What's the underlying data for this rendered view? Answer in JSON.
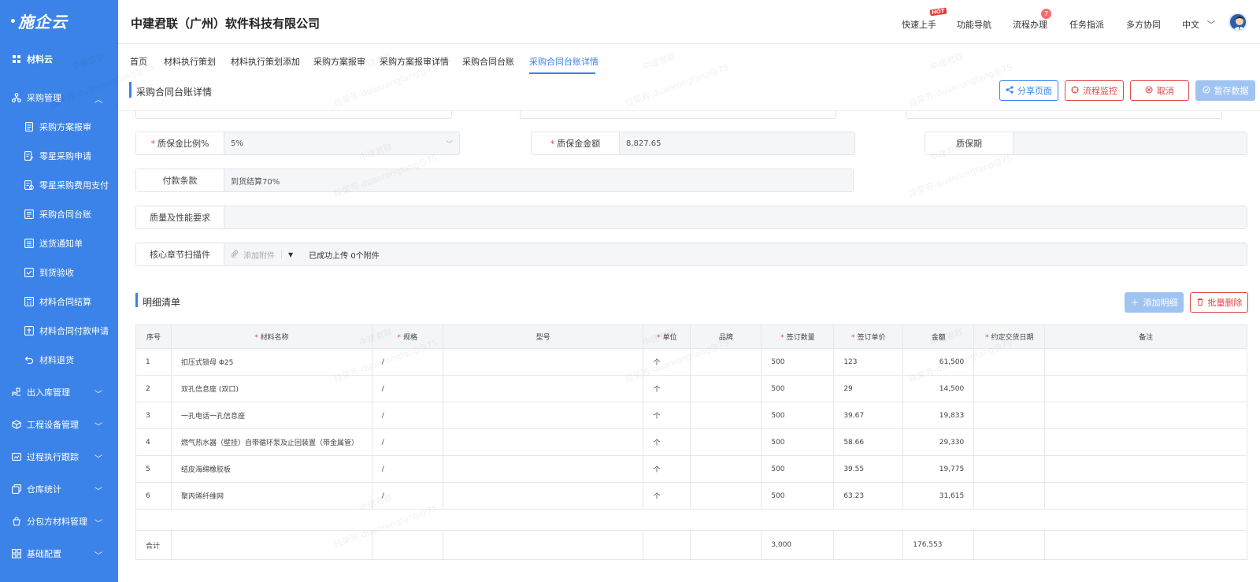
{
  "app": {
    "logo": "施企云",
    "company": "中建君联（广州）软件科技有限公司"
  },
  "sidebar": {
    "items": [
      {
        "label": "材料云",
        "icon": "grid-icon"
      },
      {
        "label": "采购管理",
        "icon": "branch-icon"
      },
      {
        "label": "采购方案报审",
        "icon": "doc-icon"
      },
      {
        "label": "零星采购申请",
        "icon": "doc-edit-icon"
      },
      {
        "label": "零星采购费用支付",
        "icon": "doc-pay-icon"
      },
      {
        "label": "采购合同台账",
        "icon": "book-icon"
      },
      {
        "label": "送货通知单",
        "icon": "list-icon"
      },
      {
        "label": "到货验收",
        "icon": "check-doc-icon"
      },
      {
        "label": "材料合同结算",
        "icon": "calc-icon"
      },
      {
        "label": "材料合同付款申请",
        "icon": "pay-doc-icon"
      },
      {
        "label": "材料退货",
        "icon": "return-icon"
      },
      {
        "label": "出入库管理",
        "icon": "hand-icon"
      },
      {
        "label": "工程设备管理",
        "icon": "box-icon"
      },
      {
        "label": "过程执行跟踪",
        "icon": "track-icon"
      },
      {
        "label": "仓库统计",
        "icon": "stack-icon"
      },
      {
        "label": "分包方材料管理",
        "icon": "bag-icon"
      },
      {
        "label": "基础配置",
        "icon": "apps-icon"
      }
    ]
  },
  "header": {
    "nav": [
      "快速上手",
      "功能导航",
      "流程办理",
      "任务指派",
      "多方协同",
      "中文"
    ],
    "hot_badge": "HOT",
    "process_count": "7"
  },
  "tabs": [
    "首页",
    "材料执行策划",
    "材料执行策划添加",
    "采购方案报审",
    "采购方案报审详情",
    "采购合同台账",
    "采购合同台账详情"
  ],
  "page": {
    "title": "采购合同台账详情",
    "buttons": {
      "share": "分享页面",
      "monitor": "流程监控",
      "cancel": "取消",
      "save": "暂存数据"
    }
  },
  "form": {
    "warranty_ratio_label": "质保金比例%",
    "warranty_ratio_value": "5%",
    "warranty_amount_label": "质保金金额",
    "warranty_amount_value": "8,827.65",
    "warranty_period_label": "质保期",
    "warranty_period_value": "",
    "payment_terms_label": "付款条款",
    "payment_terms_value": "到货结算70%",
    "quality_label": "质量及性能要求",
    "quality_value": "",
    "scan_label": "核心章节扫描件",
    "attach_label": "添加附件",
    "upload_status": "已成功上传 0个附件"
  },
  "detail": {
    "title": "明细清单",
    "add_button": "添加明细",
    "batch_delete_button": "批量删除",
    "columns": [
      "序号",
      "材料名称",
      "规格",
      "型号",
      "单位",
      "品牌",
      "签订数量",
      "签订单价",
      "金额",
      "约定交货日期",
      "备注"
    ],
    "required_columns": [
      "材料名称",
      "规格",
      "单位",
      "签订数量",
      "签订单价",
      "约定交货日期"
    ],
    "rows": [
      {
        "no": "1",
        "name": "扣压式锁母 Φ25",
        "spec": "/",
        "model": "",
        "unit": "个",
        "brand": "",
        "qty": "500",
        "price": "123",
        "amount": "61,500",
        "date": "",
        "remark": ""
      },
      {
        "no": "2",
        "name": "双孔信息座 (双口)",
        "spec": "/",
        "model": "",
        "unit": "个",
        "brand": "",
        "qty": "500",
        "price": "29",
        "amount": "14,500",
        "date": "",
        "remark": ""
      },
      {
        "no": "3",
        "name": "一孔电话一孔信息座",
        "spec": "/",
        "model": "",
        "unit": "个",
        "brand": "",
        "qty": "500",
        "price": "39.67",
        "amount": "19,833",
        "date": "",
        "remark": ""
      },
      {
        "no": "4",
        "name": "燃气热水器（壁挂）自带循环泵及止回装置（带金属管）",
        "spec": "/",
        "model": "",
        "unit": "个",
        "brand": "",
        "qty": "500",
        "price": "58.66",
        "amount": "29,330",
        "date": "",
        "remark": ""
      },
      {
        "no": "5",
        "name": "结皮海绵橡胶板",
        "spec": "/",
        "model": "",
        "unit": "个",
        "brand": "",
        "qty": "500",
        "price": "39.55",
        "amount": "19,775",
        "date": "",
        "remark": ""
      },
      {
        "no": "6",
        "name": "聚丙烯纤维网",
        "spec": "/",
        "model": "",
        "unit": "个",
        "brand": "",
        "qty": "500",
        "price": "63.23",
        "amount": "31,615",
        "date": "",
        "remark": ""
      }
    ],
    "total_label": "合计",
    "total_qty": "3,000",
    "total_amount": "176,553"
  },
  "watermark": {
    "line1": "中建君联",
    "line2": "段荣芳-duanrongfang@75"
  }
}
